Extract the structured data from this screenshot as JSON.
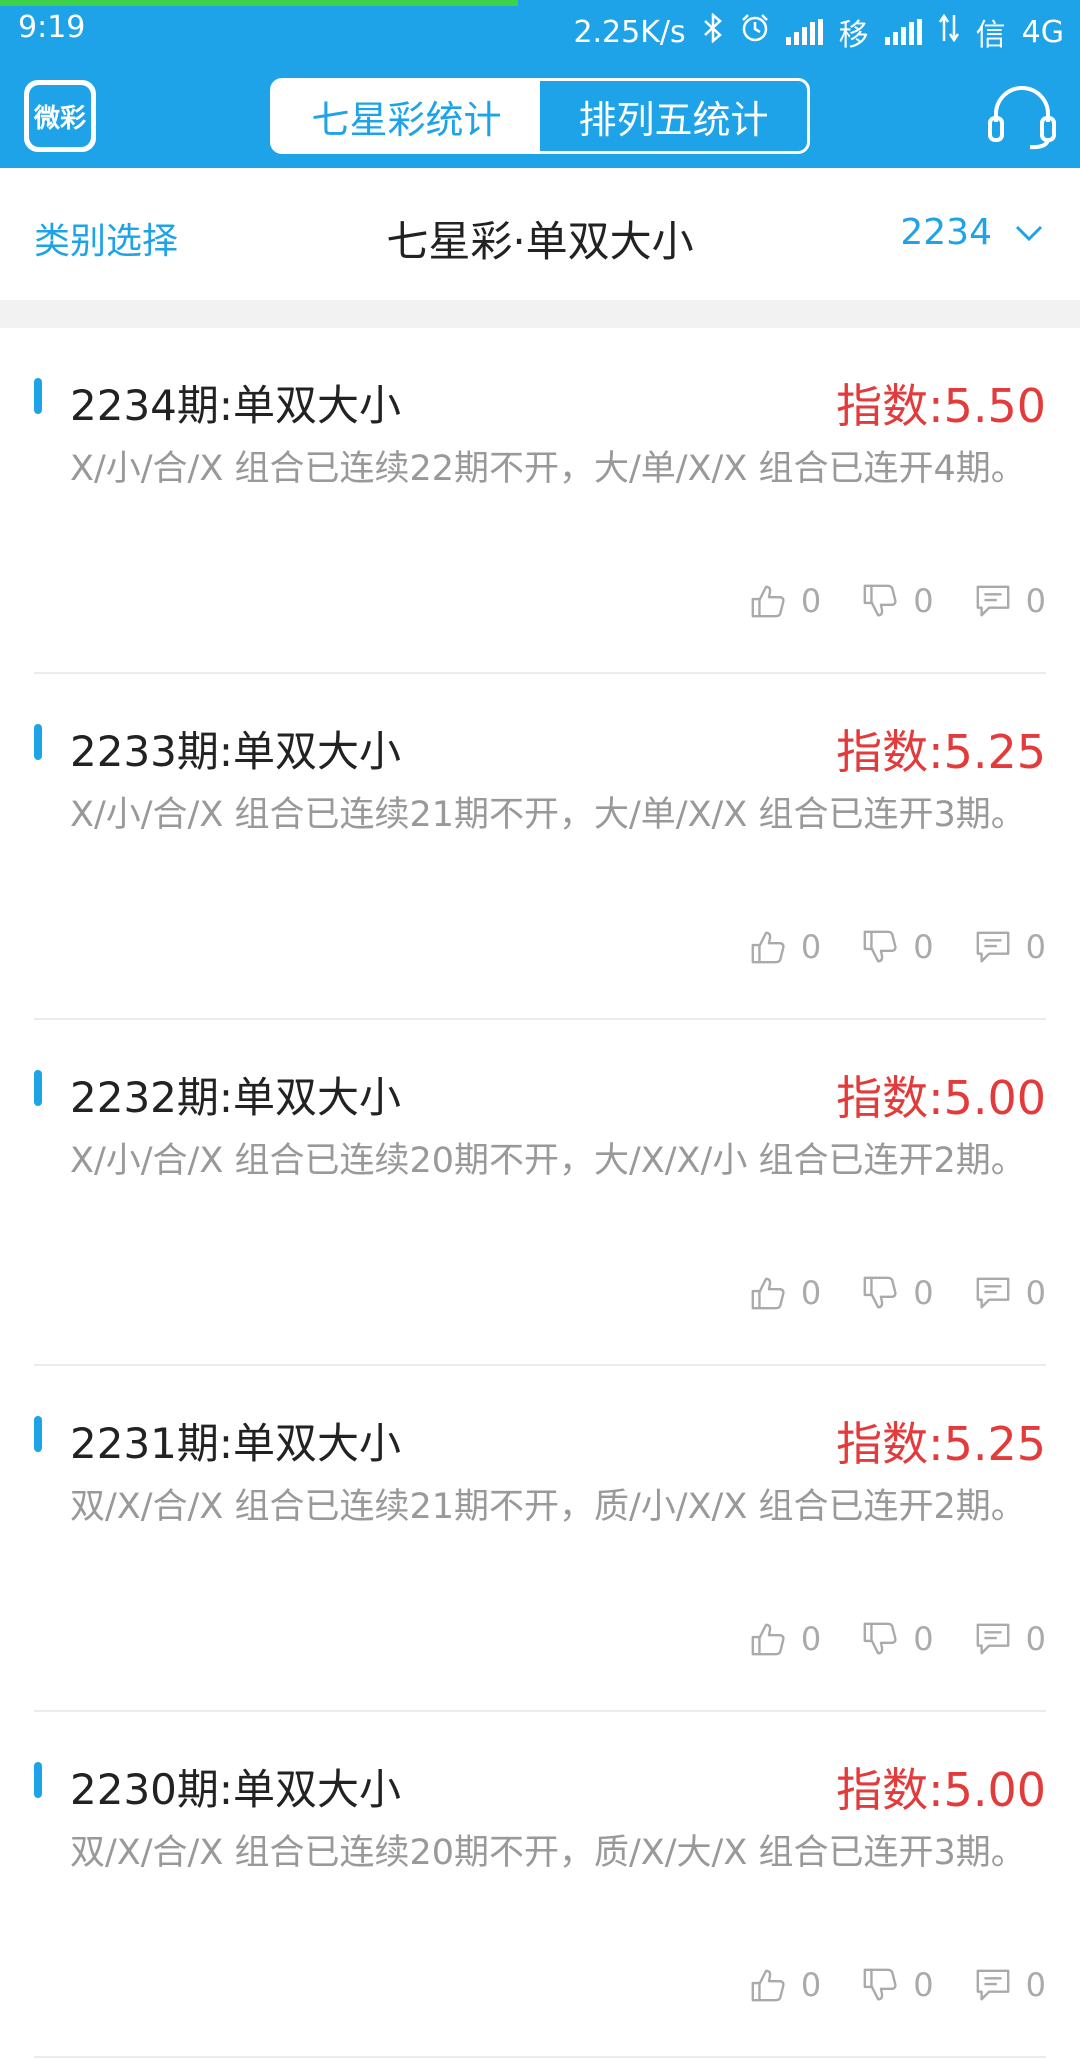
{
  "status_bar": {
    "time": "9:19",
    "net_speed": "2.25K/s",
    "carrier1": "移",
    "carrier2": "信",
    "network": "4G"
  },
  "header": {
    "logo_text": "微彩",
    "tabs": [
      {
        "label": "七星彩统计",
        "active": true
      },
      {
        "label": "排列五统计",
        "active": false
      }
    ],
    "headset_icon": "headset-icon"
  },
  "filter": {
    "category_label": "类别选择",
    "title": "七星彩·单双大小",
    "issue_value": "2234"
  },
  "items": [
    {
      "title": "2234期:单双大小",
      "index": "指数:5.50",
      "desc": "X/小/合/X 组合已连续22期不开，大/单/X/X 组合已连开4期。",
      "likes": "0",
      "dislikes": "0",
      "comments": "0"
    },
    {
      "title": "2233期:单双大小",
      "index": "指数:5.25",
      "desc": "X/小/合/X 组合已连续21期不开，大/单/X/X 组合已连开3期。",
      "likes": "0",
      "dislikes": "0",
      "comments": "0"
    },
    {
      "title": "2232期:单双大小",
      "index": "指数:5.00",
      "desc": "X/小/合/X 组合已连续20期不开，大/X/X/小 组合已连开2期。",
      "likes": "0",
      "dislikes": "0",
      "comments": "0"
    },
    {
      "title": "2231期:单双大小",
      "index": "指数:5.25",
      "desc": "双/X/合/X 组合已连续21期不开，质/小/X/X 组合已连开2期。",
      "likes": "0",
      "dislikes": "0",
      "comments": "0"
    },
    {
      "title": "2230期:单双大小",
      "index": "指数:5.00",
      "desc": "双/X/合/X 组合已连续20期不开，质/X/大/X 组合已连开3期。",
      "likes": "0",
      "dislikes": "0",
      "comments": "0"
    }
  ],
  "colors": {
    "primary": "#1fa3e8",
    "index_red": "#e33b3b",
    "text_dark": "#222222",
    "text_gray": "#999999"
  }
}
